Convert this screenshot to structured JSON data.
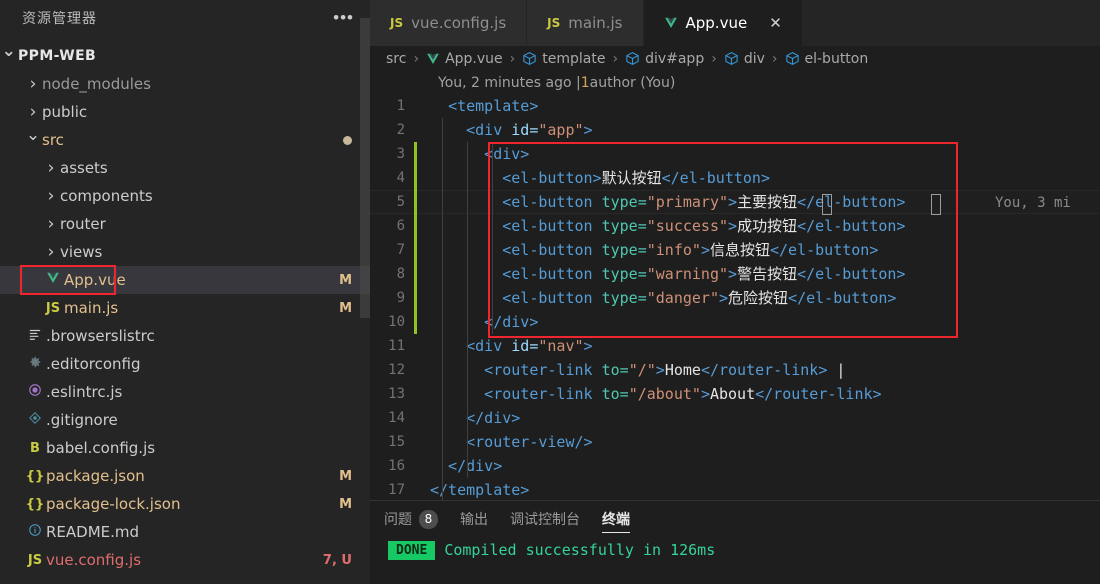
{
  "sidebar": {
    "title": "资源管理器",
    "more_label": "•••",
    "root": {
      "label": "PPM-WEB",
      "chevron": "chevron-down-icon"
    },
    "items": [
      {
        "label": "node_modules",
        "type": "folder",
        "chevron": "chevron-right-icon",
        "indent": 1,
        "icon": "",
        "icon_color": "",
        "badge": "",
        "dim": true
      },
      {
        "label": "public",
        "type": "folder",
        "chevron": "chevron-right-icon",
        "indent": 1,
        "icon": "",
        "icon_color": "",
        "badge": ""
      },
      {
        "label": "src",
        "type": "folder",
        "chevron": "chevron-down-icon",
        "indent": 1,
        "icon": "",
        "icon_color": "",
        "badge": "dot",
        "label_color": "#E2C08D"
      },
      {
        "label": "assets",
        "type": "folder",
        "chevron": "chevron-right-icon",
        "indent": 2,
        "icon": "",
        "icon_color": "",
        "badge": ""
      },
      {
        "label": "components",
        "type": "folder",
        "chevron": "chevron-right-icon",
        "indent": 2,
        "icon": "",
        "icon_color": "",
        "badge": ""
      },
      {
        "label": "router",
        "type": "folder",
        "chevron": "chevron-right-icon",
        "indent": 2,
        "icon": "",
        "icon_color": "",
        "badge": ""
      },
      {
        "label": "views",
        "type": "folder",
        "chevron": "chevron-right-icon",
        "indent": 2,
        "icon": "",
        "icon_color": "",
        "badge": ""
      },
      {
        "label": "App.vue",
        "type": "file",
        "chevron": "",
        "indent": 2,
        "icon": "vue-icon",
        "icon_color": "#41b883",
        "badge": "M",
        "selected": true,
        "label_color": "#E2C08D"
      },
      {
        "label": "main.js",
        "type": "file",
        "chevron": "",
        "indent": 2,
        "icon": "JS",
        "icon_color": "#cbcb41",
        "badge": "M",
        "label_color": "#E2C08D"
      },
      {
        "label": ".browserslistrc",
        "type": "file",
        "chevron": "",
        "indent": 1,
        "icon": "lines-icon",
        "icon_color": "#cccccc",
        "badge": ""
      },
      {
        "label": ".editorconfig",
        "type": "file",
        "chevron": "",
        "indent": 1,
        "icon": "gear-icon",
        "icon_color": "#6d8086",
        "badge": ""
      },
      {
        "label": ".eslintrc.js",
        "type": "file",
        "chevron": "",
        "indent": 1,
        "icon": "eslint-icon",
        "icon_color": "#a074c4",
        "badge": ""
      },
      {
        "label": ".gitignore",
        "type": "file",
        "chevron": "",
        "indent": 1,
        "icon": "git-icon",
        "icon_color": "#4e8ca3",
        "badge": ""
      },
      {
        "label": "babel.config.js",
        "type": "file",
        "chevron": "",
        "indent": 1,
        "icon": "B",
        "icon_color": "#cbcb41",
        "badge": ""
      },
      {
        "label": "package.json",
        "type": "file",
        "chevron": "",
        "indent": 1,
        "icon": "{}",
        "icon_color": "#cbcb41",
        "badge": "M",
        "label_color": "#E2C08D"
      },
      {
        "label": "package-lock.json",
        "type": "file",
        "chevron": "",
        "indent": 1,
        "icon": "{}",
        "icon_color": "#cbcb41",
        "badge": "M",
        "label_color": "#E2C08D"
      },
      {
        "label": "README.md",
        "type": "file",
        "chevron": "",
        "indent": 1,
        "icon": "info-icon",
        "icon_color": "#4e9ac3",
        "badge": ""
      },
      {
        "label": "vue.config.js",
        "type": "file",
        "chevron": "",
        "indent": 1,
        "icon": "JS",
        "icon_color": "#cbcb41",
        "badge": "7, U",
        "label_color": "#e06c6c",
        "badge_color": "#e06c6c"
      }
    ]
  },
  "tabs": [
    {
      "label": "vue.config.js",
      "icon": "JS",
      "icon_color": "#cbcb41",
      "active": false,
      "close": ""
    },
    {
      "label": "main.js",
      "icon": "JS",
      "icon_color": "#cbcb41",
      "active": false,
      "close": ""
    },
    {
      "label": "App.vue",
      "icon": "vue-icon",
      "icon_color": "#41b883",
      "active": true,
      "close": "✕"
    }
  ],
  "breadcrumb": {
    "sep": "›",
    "items": [
      {
        "label": "src",
        "icon": ""
      },
      {
        "label": "App.vue",
        "icon": "vue-icon"
      },
      {
        "label": "template",
        "icon": "symbol-cube-icon"
      },
      {
        "label": "div#app",
        "icon": "symbol-cube-icon"
      },
      {
        "label": "div",
        "icon": "symbol-cube-icon"
      },
      {
        "label": "el-button",
        "icon": "symbol-cube-icon"
      }
    ]
  },
  "blame": {
    "prefix": "You, 2 minutes ago | ",
    "count": "1",
    "suffix": " author (You)",
    "inline": "You, 3 mi"
  },
  "code": {
    "lines": [
      {
        "n": "1",
        "changed": false,
        "tokens": [
          {
            "t": "  ",
            "c": "t-punc"
          },
          {
            "t": "<template>",
            "c": "t-tag"
          }
        ]
      },
      {
        "n": "2",
        "changed": false,
        "tokens": [
          {
            "t": "    <div ",
            "c": "t-tag"
          },
          {
            "t": "id=",
            "c": "t-attr"
          },
          {
            "t": "\"app\"",
            "c": "t-str"
          },
          {
            "t": ">",
            "c": "t-tag"
          }
        ]
      },
      {
        "n": "3",
        "changed": true,
        "tokens": [
          {
            "t": "      <div>",
            "c": "t-tag"
          }
        ]
      },
      {
        "n": "4",
        "changed": true,
        "tokens": [
          {
            "t": "        <el-button>",
            "c": "t-tag"
          },
          {
            "t": "默认按钮",
            "c": "t-white"
          },
          {
            "t": "</el-button>",
            "c": "t-tag"
          }
        ]
      },
      {
        "n": "5",
        "changed": true,
        "current": true,
        "tokens": [
          {
            "t": "        <el-button ",
            "c": "t-tag"
          },
          {
            "t": "type=",
            "c": "t-tagc"
          },
          {
            "t": "\"primary\"",
            "c": "t-str"
          },
          {
            "t": ">",
            "c": "t-tag"
          },
          {
            "t": "主要按钮",
            "c": "t-white"
          },
          {
            "t": "</el-button>",
            "c": "t-tag"
          }
        ]
      },
      {
        "n": "6",
        "changed": true,
        "tokens": [
          {
            "t": "        <el-button ",
            "c": "t-tag"
          },
          {
            "t": "type=",
            "c": "t-tagc"
          },
          {
            "t": "\"success\"",
            "c": "t-str"
          },
          {
            "t": ">",
            "c": "t-tag"
          },
          {
            "t": "成功按钮",
            "c": "t-white"
          },
          {
            "t": "</el-button>",
            "c": "t-tag"
          }
        ]
      },
      {
        "n": "7",
        "changed": true,
        "tokens": [
          {
            "t": "        <el-button ",
            "c": "t-tag"
          },
          {
            "t": "type=",
            "c": "t-tagc"
          },
          {
            "t": "\"info\"",
            "c": "t-str"
          },
          {
            "t": ">",
            "c": "t-tag"
          },
          {
            "t": "信息按钮",
            "c": "t-white"
          },
          {
            "t": "</el-button>",
            "c": "t-tag"
          }
        ]
      },
      {
        "n": "8",
        "changed": true,
        "tokens": [
          {
            "t": "        <el-button ",
            "c": "t-tag"
          },
          {
            "t": "type=",
            "c": "t-tagc"
          },
          {
            "t": "\"warning\"",
            "c": "t-str"
          },
          {
            "t": ">",
            "c": "t-tag"
          },
          {
            "t": "警告按钮",
            "c": "t-white"
          },
          {
            "t": "</el-button>",
            "c": "t-tag"
          }
        ]
      },
      {
        "n": "9",
        "changed": true,
        "tokens": [
          {
            "t": "        <el-button ",
            "c": "t-tag"
          },
          {
            "t": "type=",
            "c": "t-tagc"
          },
          {
            "t": "\"danger\"",
            "c": "t-str"
          },
          {
            "t": ">",
            "c": "t-tag"
          },
          {
            "t": "危险按钮",
            "c": "t-white"
          },
          {
            "t": "</el-button>",
            "c": "t-tag"
          }
        ]
      },
      {
        "n": "10",
        "changed": true,
        "tokens": [
          {
            "t": "      </div>",
            "c": "t-tag"
          }
        ]
      },
      {
        "n": "11",
        "changed": false,
        "tokens": [
          {
            "t": "    <div ",
            "c": "t-tag"
          },
          {
            "t": "id=",
            "c": "t-attr"
          },
          {
            "t": "\"nav\"",
            "c": "t-str"
          },
          {
            "t": ">",
            "c": "t-tag"
          }
        ]
      },
      {
        "n": "12",
        "changed": false,
        "tokens": [
          {
            "t": "      <router-link ",
            "c": "t-tag"
          },
          {
            "t": "to=",
            "c": "t-tagc"
          },
          {
            "t": "\"/\"",
            "c": "t-str"
          },
          {
            "t": ">",
            "c": "t-tag"
          },
          {
            "t": "Home",
            "c": "t-white"
          },
          {
            "t": "</router-link>",
            "c": "t-tag"
          },
          {
            "t": " |",
            "c": "t-white"
          }
        ]
      },
      {
        "n": "13",
        "changed": false,
        "tokens": [
          {
            "t": "      <router-link ",
            "c": "t-tag"
          },
          {
            "t": "to=",
            "c": "t-tagc"
          },
          {
            "t": "\"/about\"",
            "c": "t-str"
          },
          {
            "t": ">",
            "c": "t-tag"
          },
          {
            "t": "About",
            "c": "t-white"
          },
          {
            "t": "</router-link>",
            "c": "t-tag"
          }
        ]
      },
      {
        "n": "14",
        "changed": false,
        "tokens": [
          {
            "t": "    </div>",
            "c": "t-tag"
          }
        ]
      },
      {
        "n": "15",
        "changed": false,
        "tokens": [
          {
            "t": "    <router-view/>",
            "c": "t-tag"
          }
        ]
      },
      {
        "n": "16",
        "changed": false,
        "tokens": [
          {
            "t": "  </div>",
            "c": "t-tag"
          }
        ]
      },
      {
        "n": "17",
        "changed": false,
        "tokens": [
          {
            "t": "</template>",
            "c": "t-tag"
          }
        ]
      }
    ]
  },
  "panel": {
    "tabs": [
      {
        "label": "问题",
        "count": "8",
        "active": false
      },
      {
        "label": "输出",
        "count": "",
        "active": false
      },
      {
        "label": "调试控制台",
        "count": "",
        "active": false
      },
      {
        "label": "终端",
        "count": "",
        "active": true
      }
    ],
    "terminal": {
      "status_badge": "DONE",
      "message": "Compiled successfully in 126ms"
    }
  },
  "colors": {
    "annotation_red": "#f0262e",
    "modified_badge": "#E2C08D",
    "gutter_change": "#8ec225",
    "terminal_green": "#17c964",
    "vue_green": "#41b883"
  }
}
